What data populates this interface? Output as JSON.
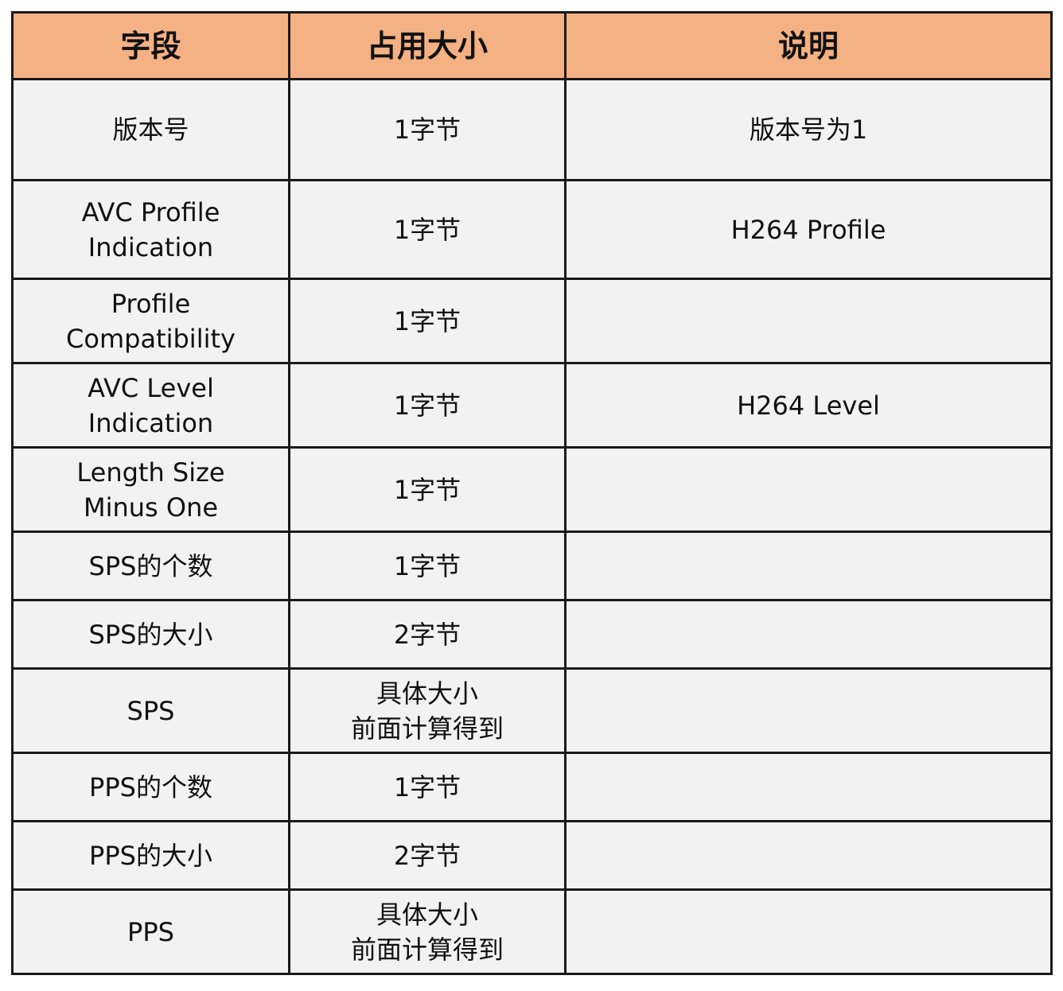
{
  "table": {
    "headers": [
      "字段",
      "占用大小",
      "说明"
    ],
    "rows": [
      {
        "field": "版本号",
        "size": "1字节",
        "desc": "版本号为1"
      },
      {
        "field": "AVC Profile\nIndication",
        "size": "1字节",
        "desc": "H264 Profile"
      },
      {
        "field": "Profile\nCompatibility",
        "size": "1字节",
        "desc": ""
      },
      {
        "field": "AVC Level\nIndication",
        "size": "1字节",
        "desc": "H264 Level"
      },
      {
        "field": "Length Size\nMinus One",
        "size": "1字节",
        "desc": ""
      },
      {
        "field": "SPS的个数",
        "size": "1字节",
        "desc": ""
      },
      {
        "field": "SPS的大小",
        "size": "2字节",
        "desc": ""
      },
      {
        "field": "SPS",
        "size": "具体大小\n前面计算得到",
        "desc": ""
      },
      {
        "field": "PPS的个数",
        "size": "1字节",
        "desc": ""
      },
      {
        "field": "PPS的大小",
        "size": "2字节",
        "desc": ""
      },
      {
        "field": "PPS",
        "size": "具体大小\n前面计算得到",
        "desc": ""
      }
    ],
    "colors": {
      "header_bg": "#f4b183",
      "row_bg": "#f2f2f2",
      "border": "#1a1a1a"
    }
  }
}
